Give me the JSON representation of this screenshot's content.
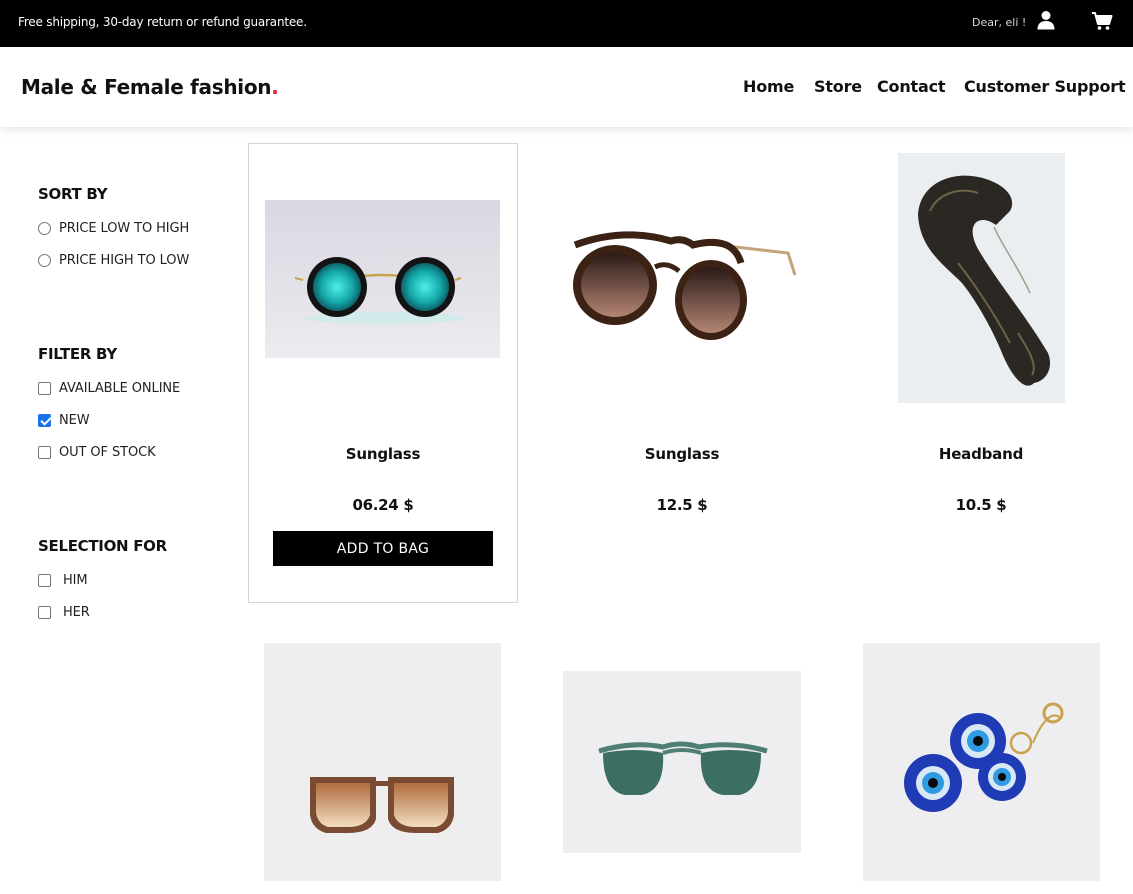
{
  "topbar": {
    "promo": "Free shipping, 30-day return or refund guarantee.",
    "greeting": "Dear, eli !",
    "icons": [
      "user-icon",
      "cart-icon"
    ]
  },
  "header": {
    "logo": "Male & Female fashion",
    "logo_dot": ".",
    "nav": [
      "Home",
      "Store",
      "Contact",
      "Customer Support"
    ]
  },
  "sidebar": {
    "sort": {
      "title": "SORT BY",
      "options": [
        {
          "label": "PRICE LOW TO HIGH",
          "selected": false
        },
        {
          "label": "PRICE HIGH TO LOW",
          "selected": false
        }
      ]
    },
    "filter": {
      "title": "FILTER BY",
      "options": [
        {
          "label": "AVAILABLE ONLINE",
          "checked": false
        },
        {
          "label": "NEW",
          "checked": true
        },
        {
          "label": "OUT OF STOCK",
          "checked": false
        }
      ]
    },
    "selection": {
      "title": "SELECTION FOR",
      "options": [
        {
          "label": "HIM",
          "checked": false
        },
        {
          "label": "HER",
          "checked": false
        }
      ]
    }
  },
  "products": [
    {
      "name": "Sunglass",
      "price": "06.24 $",
      "hovered": true,
      "cta": "ADD TO BAG"
    },
    {
      "name": "Sunglass",
      "price": "12.5 $"
    },
    {
      "name": "Headband",
      "price": "10.5 $"
    },
    {
      "name": "",
      "price": ""
    },
    {
      "name": "",
      "price": ""
    },
    {
      "name": "",
      "price": ""
    }
  ],
  "colors": {
    "topbar_bg": "#000000",
    "accent_dot": "#e4202a",
    "checkbox_checked": "#1a73e8",
    "button_bg": "#000000"
  }
}
